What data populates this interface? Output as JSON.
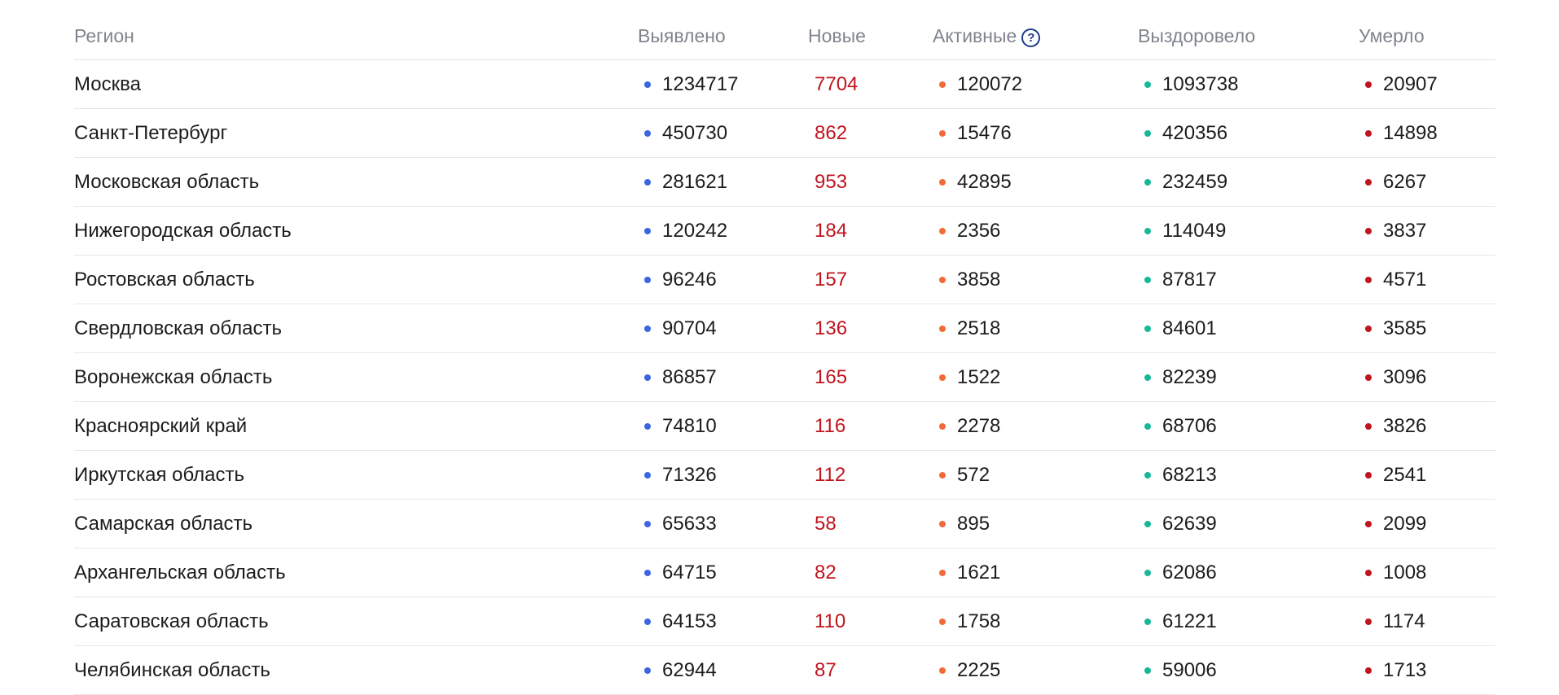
{
  "colors": {
    "found_dot": "#3b66e0",
    "active_dot": "#f26a38",
    "recovered_dot": "#17b897",
    "dead_dot": "#c0141e",
    "new_text": "#c0141e"
  },
  "header": {
    "region": "Регион",
    "found": "Выявлено",
    "new": "Новые",
    "active": "Активные",
    "active_help_icon": "?",
    "recovered": "Выздоровело",
    "dead": "Умерло"
  },
  "rows": [
    {
      "region": "Москва",
      "found": "1234717",
      "new": "7704",
      "active": "120072",
      "recovered": "1093738",
      "dead": "20907"
    },
    {
      "region": "Санкт-Петербург",
      "found": "450730",
      "new": "862",
      "active": "15476",
      "recovered": "420356",
      "dead": "14898"
    },
    {
      "region": "Московская область",
      "found": "281621",
      "new": "953",
      "active": "42895",
      "recovered": "232459",
      "dead": "6267"
    },
    {
      "region": "Нижегородская область",
      "found": "120242",
      "new": "184",
      "active": "2356",
      "recovered": "114049",
      "dead": "3837"
    },
    {
      "region": "Ростовская область",
      "found": "96246",
      "new": "157",
      "active": "3858",
      "recovered": "87817",
      "dead": "4571"
    },
    {
      "region": "Свердловская область",
      "found": "90704",
      "new": "136",
      "active": "2518",
      "recovered": "84601",
      "dead": "3585"
    },
    {
      "region": "Воронежская область",
      "found": "86857",
      "new": "165",
      "active": "1522",
      "recovered": "82239",
      "dead": "3096"
    },
    {
      "region": "Красноярский край",
      "found": "74810",
      "new": "116",
      "active": "2278",
      "recovered": "68706",
      "dead": "3826"
    },
    {
      "region": "Иркутская область",
      "found": "71326",
      "new": "112",
      "active": "572",
      "recovered": "68213",
      "dead": "2541"
    },
    {
      "region": "Самарская область",
      "found": "65633",
      "new": "58",
      "active": "895",
      "recovered": "62639",
      "dead": "2099"
    },
    {
      "region": "Архангельская область",
      "found": "64715",
      "new": "82",
      "active": "1621",
      "recovered": "62086",
      "dead": "1008"
    },
    {
      "region": "Саратовская область",
      "found": "64153",
      "new": "110",
      "active": "1758",
      "recovered": "61221",
      "dead": "1174"
    },
    {
      "region": "Челябинская область",
      "found": "62944",
      "new": "87",
      "active": "2225",
      "recovered": "59006",
      "dead": "1713"
    }
  ]
}
